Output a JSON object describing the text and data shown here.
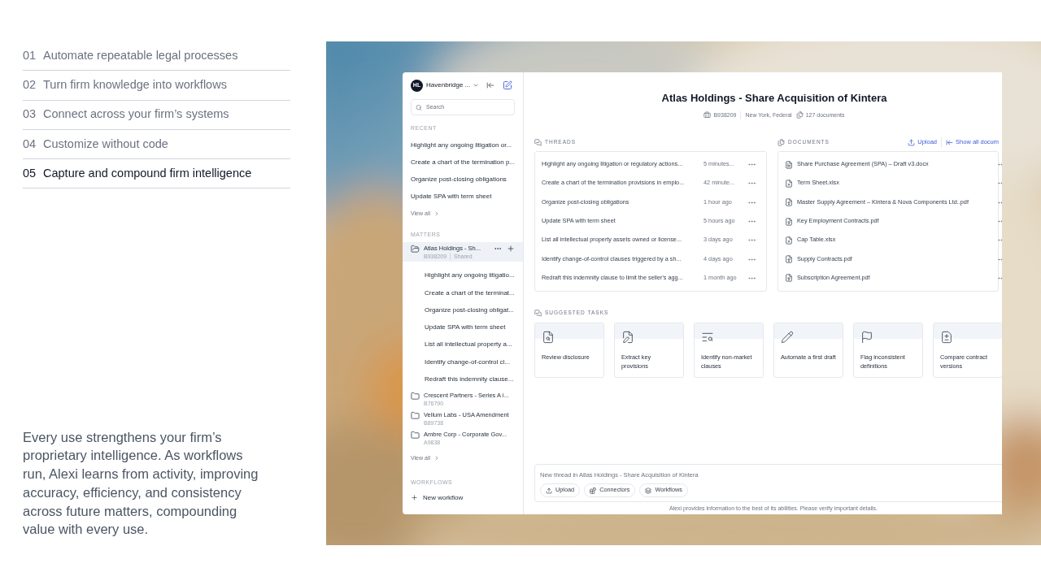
{
  "features": [
    {
      "number": "01",
      "label": "Automate repeatable legal processes",
      "selected": false
    },
    {
      "number": "02",
      "label": "Turn firm knowledge into workflows",
      "selected": false
    },
    {
      "number": "03",
      "label": "Connect across your firm’s systems",
      "selected": false
    },
    {
      "number": "04",
      "label": "Customize without code",
      "selected": false
    },
    {
      "number": "05",
      "label": "Capture and compound firm intelligence",
      "selected": true
    }
  ],
  "description": "Every use strengthens your firm’s proprietary intelligence. As workflows run, Alexi learns from activity, improving accuracy, efficiency, and consistency across future matters, compounding value with every use.",
  "app": {
    "sidebar": {
      "avatar": "HL",
      "workspace": "Havenbridge ...",
      "search": {
        "placeholder": "Search"
      },
      "recent": {
        "title": "RECENT",
        "items": [
          "Highlight any ongoing litigation or...",
          "Create a chart of the termination p...",
          "Organize post-closing obligations",
          "Update SPA with term sheet"
        ],
        "view_all": "View all"
      },
      "matters": {
        "title": "MATTERS",
        "items": [
          {
            "name": "Atlas Holdings - Sh...",
            "code": "B938209",
            "shared": "Shared",
            "selected": true,
            "expanded": true,
            "children": [
              "Highlight any ongoing litigatio...",
              "Create a chart of the terminat...",
              "Organize post-closing obligat...",
              "Update SPA with term sheet",
              "List all intellectual property a...",
              "Identify change-of-control cl...",
              "Redraft this indemnity clause..."
            ]
          },
          {
            "name": "Crescent Partners - Series A i...",
            "code": "B76790",
            "selected": false,
            "expanded": false
          },
          {
            "name": "Vellum Labs - USA Amendment",
            "code": "B89738",
            "selected": false,
            "expanded": false
          },
          {
            "name": "Ambre Corp - Corporate Gov...",
            "code": "A9838",
            "selected": false,
            "expanded": false
          }
        ],
        "view_all": "View all"
      },
      "workflows": {
        "title": "WORKFLOWS",
        "new": "New workflow"
      }
    },
    "matter": {
      "title": "Atlas Holdings - Share Acquisition of Kintera",
      "code": "B938209",
      "location": "New York, Federal",
      "documents_count": "127 documents"
    },
    "threads": {
      "title": "THREADS",
      "rows": [
        {
          "title": "Highlight any ongoing litigation or regulatory actions...",
          "time": "5 minutes..."
        },
        {
          "title": "Create a chart of the termination provisions in emplo...",
          "time": "42 minute..."
        },
        {
          "title": "Organize post-closing obligations",
          "time": "1 hour ago"
        },
        {
          "title": "Update SPA with term sheet",
          "time": "5 hours ago"
        },
        {
          "title": "List all intellectual property assets owned or license...",
          "time": "3 days ago"
        },
        {
          "title": "Identify change-of-control clauses triggered by a sh...",
          "time": "4 days ago"
        },
        {
          "title": "Redraft this indemnity clause to limit the seller's agg...",
          "time": "1 month ago"
        }
      ]
    },
    "documents": {
      "title": "DOCUMENTS",
      "upload": "Upload",
      "show_all": "Show all docum",
      "files": [
        {
          "name": "Share Purchase Agreement (SPA) – Draft v3.docx",
          "kind": "docx"
        },
        {
          "name": "Term Sheet.xlsx",
          "kind": "xlsx"
        },
        {
          "name": "Master Supply Agreement – Kintera & Nova Components Ltd..pdf",
          "kind": "pdf"
        },
        {
          "name": "Key Employment Contracts.pdf",
          "kind": "pdf"
        },
        {
          "name": "Cap Table.xlsx",
          "kind": "xlsx"
        },
        {
          "name": "Supply Contracts.pdf",
          "kind": "pdf"
        },
        {
          "name": "Subscription Agreement.pdf",
          "kind": "pdf"
        }
      ]
    },
    "suggested_tasks": {
      "title": "SUGGESTED TASKS",
      "tasks": [
        {
          "label": "Review disclosure",
          "kind": "review"
        },
        {
          "label": "Extract key provisions",
          "kind": "extract"
        },
        {
          "label": "Identify non-market clauses",
          "kind": "identify"
        },
        {
          "label": "Automate a first draft",
          "kind": "draft"
        },
        {
          "label": "Flag inconsistent definitions",
          "kind": "flag"
        },
        {
          "label": "Compare contract versions",
          "kind": "compare"
        }
      ]
    },
    "composer": {
      "placeholder": "New thread in Atlas Holdings - Share Acquisition of Kintera",
      "buttons": [
        {
          "label": "Upload",
          "kind": "upload"
        },
        {
          "label": "Connectors",
          "kind": "connectors"
        },
        {
          "label": "Workflows",
          "kind": "workflows"
        }
      ]
    },
    "disclaimer": "Alexi provides information to the best of its abilities. Please verify important details."
  }
}
